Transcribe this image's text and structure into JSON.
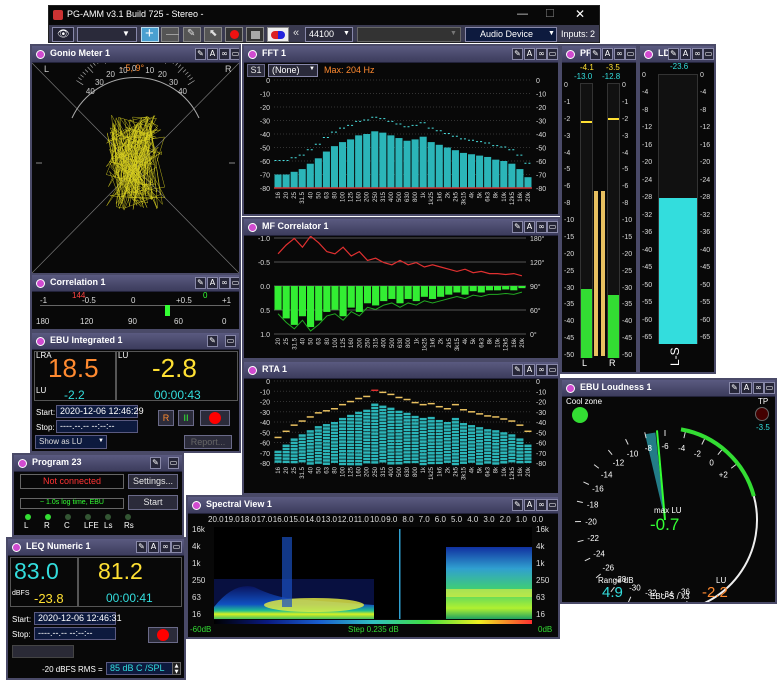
{
  "app": {
    "title": "PG-AMM v3.1 Build 725  - Stereo -",
    "inputs_label": "Inputs:",
    "inputs_value": "2"
  },
  "toolbar": {
    "sample_rate": "44100",
    "device": "Audio Device",
    "rewind_glyph": "«"
  },
  "gonio": {
    "title": "Gonio Meter 1",
    "angle": "- 5, 9°",
    "left": "L",
    "right": "R",
    "scale": [
      "40",
      "30",
      "20",
      "10",
      "0",
      "10",
      "20",
      "30",
      "40"
    ]
  },
  "correlation": {
    "title": "Correlation 1",
    "value": "144",
    "value2": "0",
    "top_scale": [
      "-1",
      "-0.5",
      "0",
      "+0.5",
      "+1"
    ],
    "bottom_scale": [
      "180",
      "120",
      "90",
      "60",
      "0"
    ]
  },
  "ebu_integrated": {
    "title": "EBU Integrated 1",
    "lra_label": "LRA",
    "lra_value": "18.5",
    "lu_label": "LU",
    "lu_value": "-2.8",
    "lu_small_label": "LU",
    "lu_small_value": "-2.2",
    "time": "00:00:43",
    "start_label": "Start:",
    "start_value": "2020-12-06 12:46:29",
    "stop_label": "Stop:",
    "stop_value": "----.--.-- --:--:--",
    "btn_r": "R",
    "btn_pause": "II",
    "show_as": "Show as LU",
    "report": "Report..."
  },
  "program": {
    "title": "Program 23",
    "status": "Not connected",
    "settings": "Settings...",
    "log": "~ 1.0s log time, EBU",
    "start": "Start",
    "channels": [
      "L",
      "R",
      "C",
      "LFE",
      "Ls",
      "Rs"
    ]
  },
  "leq": {
    "title": "LEQ Numeric 1",
    "value1": "83.0",
    "value2": "81.2",
    "dbfs_label": "dBFS",
    "dbfs_value": "-23.8",
    "time": "00:00:41",
    "start_label": "Start:",
    "start_value": "2020-12-06 12:46:31",
    "stop_label": "Stop:",
    "stop_value": "----.--.-- --:--:--",
    "rms_label": "-20 dBFS RMS =",
    "spl": "85 dB C /SPL"
  },
  "fft": {
    "title": "FFT 1",
    "s1": "S1",
    "none": "(None)",
    "max": "Max: 204 Hz",
    "y_scale": [
      "0",
      "-10",
      "-20",
      "-30",
      "-40",
      "-50",
      "-60",
      "-70",
      "-80"
    ],
    "x_labels": [
      "16",
      "20",
      "25",
      "31.5",
      "40",
      "50",
      "63",
      "80",
      "100",
      "125",
      "160",
      "200",
      "250",
      "315",
      "400",
      "500",
      "630",
      "800",
      "1k",
      "1k25",
      "1k6",
      "2k",
      "2k5",
      "3k15",
      "4k",
      "5k",
      "6k3",
      "8k",
      "10k",
      "12k5",
      "16k",
      "20k"
    ],
    "levels": [
      -70,
      -70,
      -68,
      -66,
      -62,
      -58,
      -53,
      -49,
      -46,
      -44,
      -41,
      -40,
      -38,
      -39,
      -41,
      -43,
      -45,
      -44,
      -42,
      -46,
      -48,
      -50,
      -52,
      -54,
      -55,
      -56,
      -57,
      -59,
      -60,
      -62,
      -66,
      -72
    ]
  },
  "mf": {
    "title": "MF Correlator 1",
    "left_scale": [
      "-1.0",
      "-0.5",
      "0.0",
      "0.5",
      "1.0"
    ],
    "right_scale": [
      "180°",
      "120°",
      "90°",
      "60°",
      "0°"
    ],
    "x_labels": [
      "20",
      "25",
      "31.5",
      "40",
      "50",
      "63",
      "80",
      "100",
      "125",
      "160",
      "200",
      "250",
      "315",
      "400",
      "500",
      "630",
      "800",
      "1k",
      "1k25",
      "1k6",
      "2k",
      "2k5",
      "3k15",
      "4k",
      "5k",
      "6k3",
      "8k",
      "10k",
      "12k5",
      "16k",
      "20k"
    ],
    "values": [
      0.55,
      0.75,
      0.9,
      0.7,
      0.95,
      0.8,
      0.6,
      0.55,
      0.7,
      0.5,
      0.6,
      0.4,
      0.45,
      0.35,
      0.3,
      0.4,
      0.3,
      0.35,
      0.25,
      0.3,
      0.25,
      0.2,
      0.15,
      0.2,
      0.12,
      0.15,
      0.1,
      0.1,
      0.08,
      0.1,
      0.05
    ]
  },
  "rta": {
    "title": "RTA 1",
    "y_scale": [
      "0",
      "-10",
      "-20",
      "-30",
      "-40",
      "-50",
      "-60",
      "-70",
      "-80"
    ],
    "x_labels": [
      "16",
      "20",
      "25",
      "31.5",
      "40",
      "50",
      "63",
      "80",
      "100",
      "125",
      "160",
      "200",
      "250",
      "315",
      "400",
      "500",
      "630",
      "800",
      "1k",
      "1k25",
      "1k6",
      "2k",
      "2k5",
      "3k15",
      "4k",
      "5k",
      "6k3",
      "8k",
      "10k",
      "12k5",
      "16k",
      "20k"
    ],
    "levels": [
      -68,
      -62,
      -56,
      -52,
      -48,
      -44,
      -42,
      -40,
      -36,
      -33,
      -30,
      -28,
      -22,
      -24,
      -26,
      -29,
      -31,
      -34,
      -36,
      -35,
      -38,
      -40,
      -36,
      -41,
      -43,
      -45,
      -47,
      -48,
      -50,
      -52,
      -56,
      -62
    ]
  },
  "spectral": {
    "title": "Spectral View 1",
    "top_scale": [
      "20.0",
      "19.0",
      "18.0",
      "17.0",
      "16.0",
      "15.0",
      "14.0",
      "13.0",
      "12.0",
      "11.0",
      "10.0",
      "9.0",
      "8.0",
      "7.0",
      "6.0",
      "5.0",
      "4.0",
      "3.0",
      "2.0",
      "1.0",
      "0.0"
    ],
    "y_scale": [
      "16k",
      "4k",
      "1k",
      "250",
      "63",
      "16"
    ],
    "min": "-60dB",
    "step": "Step 0.235 dB",
    "max": "0dB"
  },
  "pp": {
    "title": "PP",
    "peak_l": "-4.1",
    "peak_r": "-3.5",
    "val_l": "-13.0",
    "val_r": "-12.8",
    "scale": [
      "0",
      "-1",
      "-2",
      "-3",
      "-4",
      "-5",
      "-6",
      "-8",
      "-10",
      "-15",
      "-20",
      "-25",
      "-30",
      "-35",
      "-40",
      "-45",
      "-50"
    ],
    "ch_l": "L",
    "ch_r": "R",
    "level_l": 0.25,
    "level_r": 0.23
  },
  "ld": {
    "title": "LD",
    "top": "-23.6",
    "scale": [
      "0",
      "-4",
      "-8",
      "-12",
      "-16",
      "-20",
      "-24",
      "-28",
      "-32",
      "-36",
      "-40",
      "-45",
      "-50",
      "-55",
      "-60",
      "-65"
    ],
    "ch": "L-S",
    "level": 0.54
  },
  "ebu_loudness": {
    "title": "EBU Loudness 1",
    "cool": "Cool zone",
    "tp": "TP",
    "tp_value": "-3.5",
    "ticks": [
      "-6",
      "-4",
      "-2",
      "0",
      "+2",
      "-8",
      "-10",
      "-12",
      "-14",
      "-16",
      "-18",
      "-20",
      "-22",
      "-24",
      "-26",
      "-28",
      "-30",
      "-32",
      "-34",
      "-36"
    ],
    "max_label": "max LU",
    "max_value": "-0.7",
    "range_label": "Range dB",
    "range_value": "4.9",
    "lu_label": "LU",
    "lu_value": "-2.2",
    "mode": "EBU-S / x3"
  },
  "colors": {
    "accent_green": "#33ff33",
    "accent_cyan": "#33dddd",
    "accent_orange": "#ff8a30",
    "accent_yellow": "#ffe033",
    "accent_red": "#ff3333"
  }
}
